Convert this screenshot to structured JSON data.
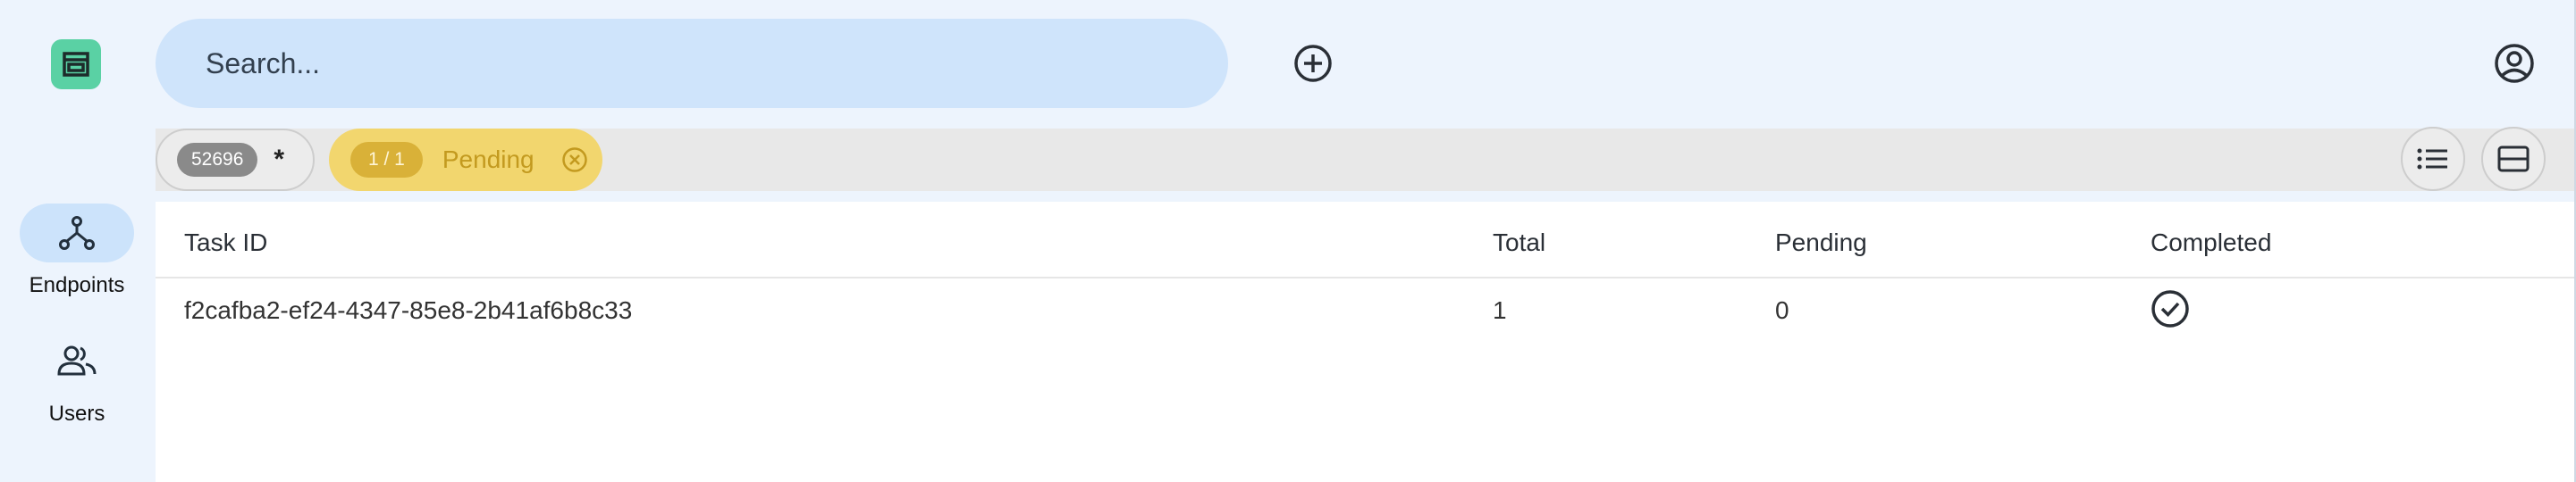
{
  "app": {
    "logo_icon": "app-logo-icon",
    "accent_color": "#5ad1a4"
  },
  "nav": {
    "items": [
      {
        "label": "Endpoints",
        "icon": "endpoints-icon",
        "active": true
      },
      {
        "label": "Users",
        "icon": "users-icon",
        "active": false
      }
    ]
  },
  "header": {
    "search": {
      "placeholder": "Search..."
    },
    "add_icon": "add-circle-icon",
    "account_icon": "account-circle-icon"
  },
  "filters": {
    "count_badge": "52696",
    "count_marker": "*",
    "status_chip": {
      "badge": "1 / 1",
      "label": "Pending",
      "color": "#f2d66e"
    },
    "view_buttons": [
      "list-view-icon",
      "split-view-icon"
    ]
  },
  "table": {
    "columns": [
      "Task ID",
      "Total",
      "Pending",
      "Completed"
    ],
    "rows": [
      {
        "task_id": "f2cafba2-ef24-4347-85e8-2b41af6b8c33",
        "total": "1",
        "pending": "0",
        "completed": "check-circle-icon"
      }
    ]
  }
}
